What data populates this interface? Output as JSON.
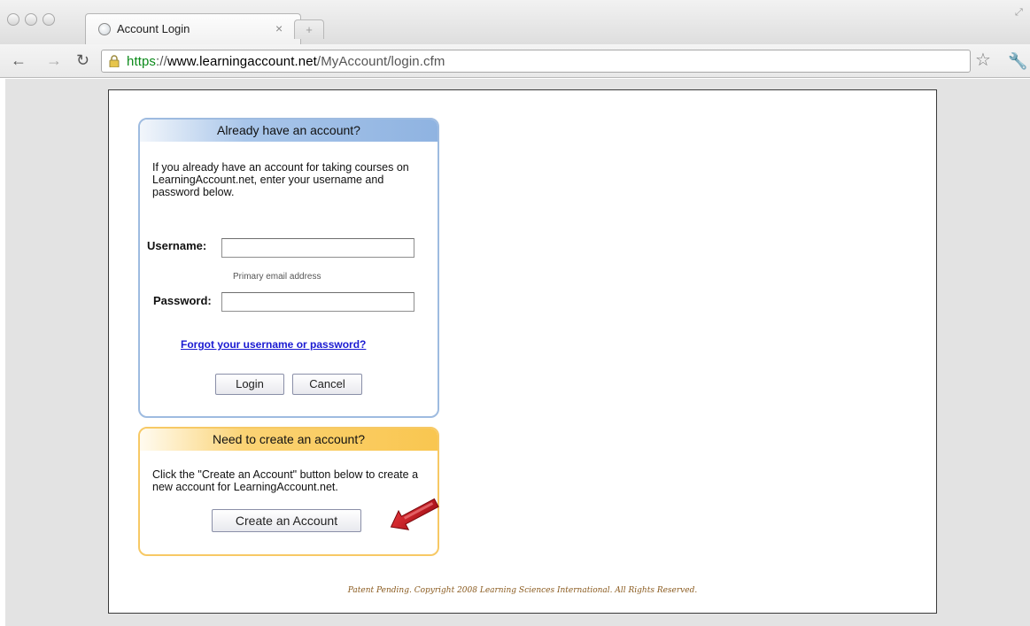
{
  "browser": {
    "tab_title": "Account Login",
    "tab_close": "×",
    "new_tab": "+",
    "url": {
      "scheme": "https",
      "separator": "://",
      "host": "www.learningaccount.net",
      "path": "/MyAccount/login.cfm"
    },
    "icons": {
      "back": "back-arrow-icon",
      "forward": "forward-arrow-icon",
      "reload": "reload-icon",
      "lock": "lock-icon",
      "bookmark": "star-icon",
      "settings": "wrench-icon"
    }
  },
  "login": {
    "title": "Already have an account?",
    "intro": "If you already have an account for taking courses on LearningAccount.net, enter your username and password below.",
    "username_label": "Username:",
    "username_value": "",
    "username_hint": "Primary email address",
    "password_label": "Password:",
    "password_value": "",
    "forgot_link": "Forgot your username or password?",
    "login_button": "Login",
    "cancel_button": "Cancel"
  },
  "create": {
    "title": "Need to create an account?",
    "intro": "Click the \"Create an Account\" button below to create a new account for LearningAccount.net.",
    "button": "Create an Account"
  },
  "footer": "Patent Pending. Copyright 2008 Learning Sciences International. All Rights Reserved.",
  "colors": {
    "login_accent": "#8fb3e1",
    "create_accent": "#f9c650",
    "link": "#1a1ad2",
    "arrow": "#c4151c",
    "url_scheme": "#0b8a1a"
  }
}
